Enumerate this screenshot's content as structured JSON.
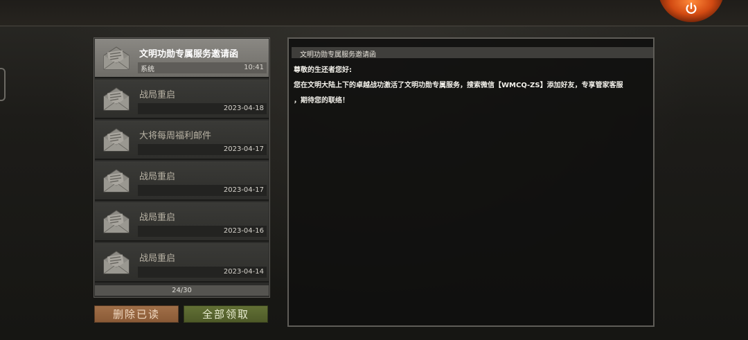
{
  "mails": [
    {
      "title": "文明功勋专属服务邀请函",
      "sender": "系统",
      "date": "10:41",
      "selected": true
    },
    {
      "title": "战局重启",
      "sender": "",
      "date": "2023-04-18",
      "selected": false
    },
    {
      "title": "大将每周福利邮件",
      "sender": "",
      "date": "2023-04-17",
      "selected": false
    },
    {
      "title": "战局重启",
      "sender": "",
      "date": "2023-04-17",
      "selected": false
    },
    {
      "title": "战局重启",
      "sender": "",
      "date": "2023-04-16",
      "selected": false
    },
    {
      "title": "战局重启",
      "sender": "",
      "date": "2023-04-14",
      "selected": false
    }
  ],
  "pager": "24/30",
  "buttons": {
    "delete_read": "删除已读",
    "claim_all": "全部领取"
  },
  "detail": {
    "title": "文明功勋专属服务邀请函",
    "greeting": "尊敬的生还者您好:",
    "body_line1": "您在文明大陆上下的卓越战功激活了文明功勋专属服务，搜索微信【WMCQ-ZS】添加好友，专享管家客服",
    "body_line2": "，期待您的联络！"
  },
  "icons": {
    "power": "power-icon",
    "mail": "mail-envelope-icon"
  },
  "colors": {
    "selected_row": "#7e7c77",
    "delete_button": "#94623e",
    "claim_button": "#56622d",
    "power_glow": "#e05a1c"
  }
}
